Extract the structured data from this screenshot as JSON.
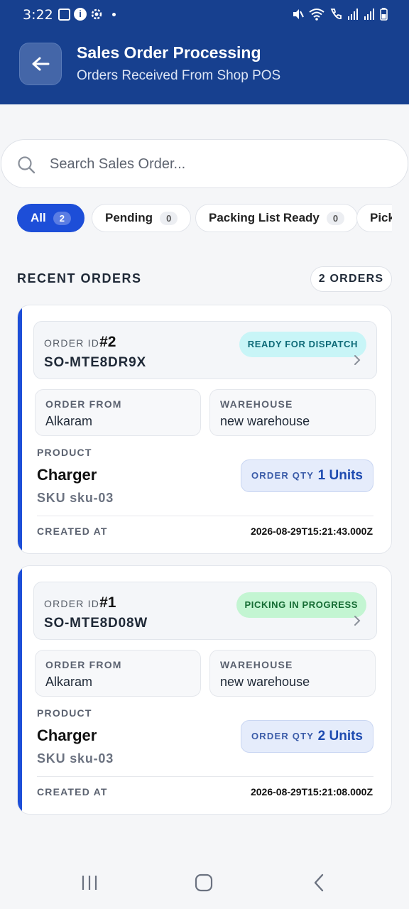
{
  "status_bar": {
    "time": "3:22"
  },
  "header": {
    "title": "Sales Order Processing",
    "subtitle": "Orders Received From Shop POS"
  },
  "search": {
    "placeholder": "Search Sales Order...",
    "value": ""
  },
  "filters": [
    {
      "label": "All",
      "count": "2",
      "active": true
    },
    {
      "label": "Pending",
      "count": "0",
      "active": false
    },
    {
      "label": "Packing List Ready",
      "count": "0",
      "active": false
    },
    {
      "label": "Pick",
      "count": "",
      "active": false
    }
  ],
  "section": {
    "title": "RECENT ORDERS",
    "count_label": "2 ORDERS"
  },
  "orders": [
    {
      "id_label": "ORDER ID",
      "id_num": "#2",
      "order_no": "SO-MTE8DR9X",
      "status": "READY FOR DISPATCH",
      "from_label": "ORDER FROM",
      "from": "Alkaram",
      "warehouse_label": "WAREHOUSE",
      "warehouse": "new warehouse",
      "product_label": "PRODUCT",
      "product": "Charger",
      "sku": "SKU sku-03",
      "qty_label": "ORDER QTY",
      "qty": "1 Units",
      "created_label": "CREATED AT",
      "created": "2026-08-29T15:21:43.000Z"
    },
    {
      "id_label": "ORDER ID",
      "id_num": "#1",
      "order_no": "SO-MTE8D08W",
      "status": "PICKING IN PROGRESS",
      "from_label": "ORDER FROM",
      "from": "Alkaram",
      "warehouse_label": "WAREHOUSE",
      "warehouse": "new warehouse",
      "product_label": "PRODUCT",
      "product": "Charger",
      "sku": "SKU sku-03",
      "qty_label": "ORDER QTY",
      "qty": "2 Units",
      "created_label": "CREATED AT",
      "created": "2026-08-29T15:21:08.000Z"
    }
  ],
  "colors": {
    "header_bg": "#17408f",
    "accent": "#1d4ed8",
    "dispatch_bg": "#c8f5f7",
    "picking_bg": "#c3f5d2"
  }
}
